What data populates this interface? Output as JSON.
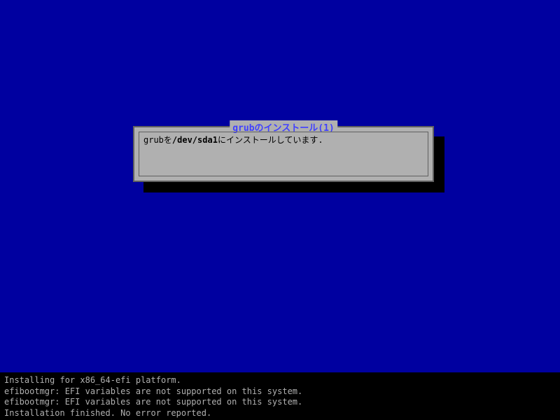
{
  "dialog": {
    "title": "grubのインストール(1)",
    "message_prefix": "grubを",
    "message_device": "/dev/sda1",
    "message_suffix": "にインストールしています."
  },
  "console": {
    "lines": [
      "Installing for x86_64-efi platform.",
      "efibootmgr: EFI variables are not supported on this system.",
      "efibootmgr: EFI variables are not supported on this system.",
      "Installation finished. No error reported."
    ]
  }
}
